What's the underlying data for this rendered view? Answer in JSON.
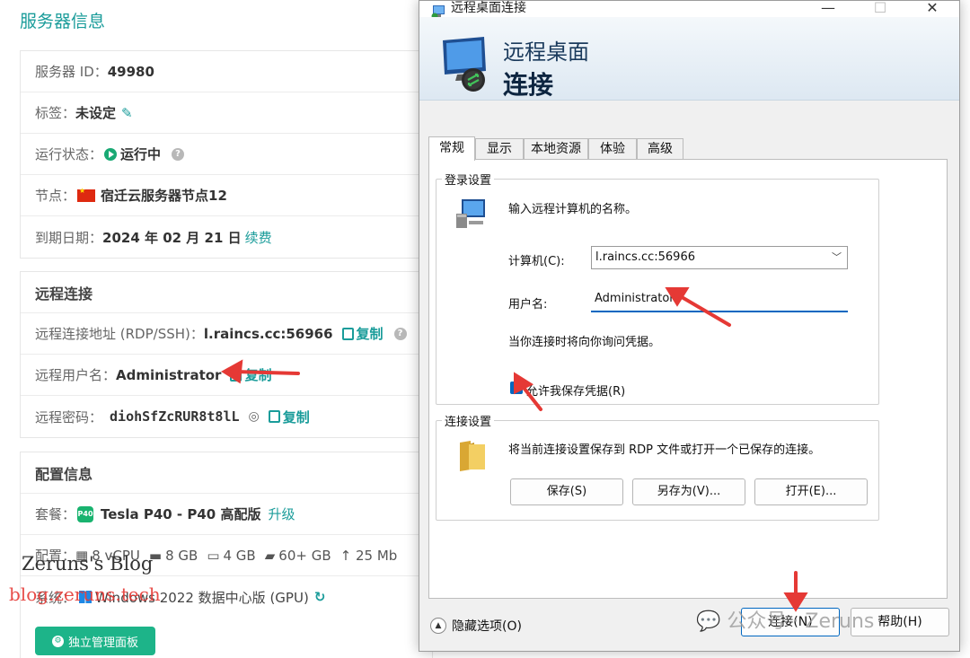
{
  "page": {
    "section_title": "服务器信息",
    "server_info": {
      "id_label": "服务器 ID：",
      "id_value": "49980",
      "tag_label": "标签：",
      "tag_value": "未设定",
      "status_label": "运行状态：",
      "status_value": "运行中",
      "node_label": "节点：",
      "node_value": "宿迁云服务器节点12",
      "expiry_label": "到期日期：",
      "expiry_value": "2024 年 02 月 21 日",
      "renew_link": "续费"
    },
    "remote": {
      "heading": "远程连接",
      "address_label": "远程连接地址 (RDP/SSH)：",
      "address_value": "l.raincs.cc:56966",
      "copy_label": "复制",
      "username_label": "远程用户名：",
      "username_value": "Administrator",
      "password_label": "远程密码：",
      "password_value": "diohSfZcRUR8t8lL"
    },
    "config": {
      "heading": "配置信息",
      "plan_label": "套餐：",
      "plan_badge": "P40",
      "plan_value": "Tesla P40 - P40 高配版",
      "upgrade_link": "升级",
      "spec_label": "配置：",
      "spec_cpu": "8 vCPU",
      "spec_ram": "8 GB",
      "spec_gpu": "4 GB",
      "spec_disk": "60+ GB",
      "spec_net": "↑ 25 Mb",
      "os_label": "系统：",
      "os_value": "Windows 2022 数据中心版 (GPU)",
      "panel_button": "独立管理面板"
    }
  },
  "watermarks": {
    "blog_name": "Zeruns's Blog",
    "blog_url": "blog.zeruns.tech",
    "wechat": "公众号 · Zeruns"
  },
  "rdp": {
    "window_title": "远程桌面连接",
    "banner_line1": "远程桌面",
    "banner_line2": "连接",
    "tabs": [
      "常规",
      "显示",
      "本地资源",
      "体验",
      "高级"
    ],
    "login_group": "登录设置",
    "login_prompt": "输入远程计算机的名称。",
    "computer_label": "计算机(C):",
    "computer_value": "l.raincs.cc:56966",
    "username_label": "用户名:",
    "username_value": "Administrator",
    "credential_note": "当你连接时将向你询问凭据。",
    "save_cred_label": "允许我保存凭据(R)",
    "save_cred_checked": true,
    "conn_group": "连接设置",
    "conn_desc": "将当前连接设置保存到 RDP 文件或打开一个已保存的连接。",
    "btn_save": "保存(S)",
    "btn_save_as": "另存为(V)...",
    "btn_open": "打开(E)...",
    "hide_options": "隐藏选项(O)",
    "btn_connect": "连接(N)",
    "btn_help": "帮助(H)",
    "accent_color": "#0067c0"
  },
  "annotation_color": "#e53935"
}
